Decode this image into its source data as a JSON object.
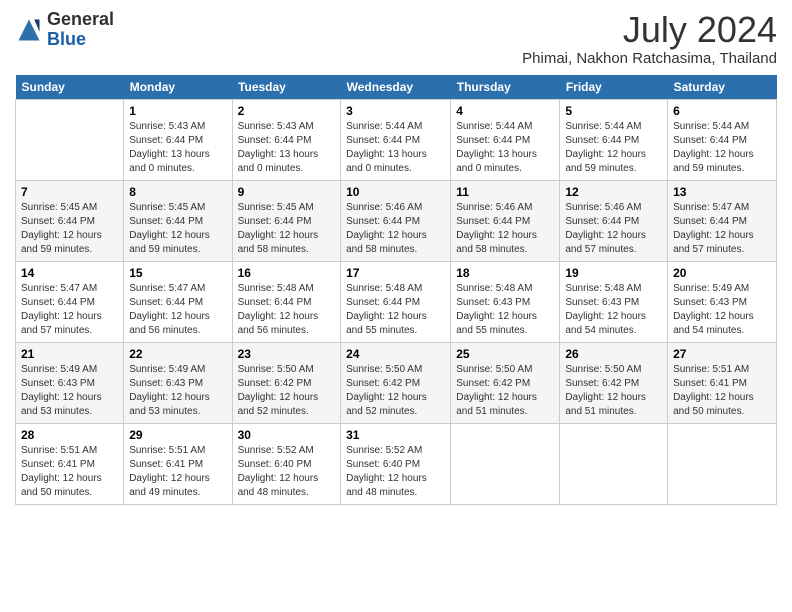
{
  "header": {
    "logo_general": "General",
    "logo_blue": "Blue",
    "month_year": "July 2024",
    "location": "Phimai, Nakhon Ratchasima, Thailand"
  },
  "weekdays": [
    "Sunday",
    "Monday",
    "Tuesday",
    "Wednesday",
    "Thursday",
    "Friday",
    "Saturday"
  ],
  "weeks": [
    [
      {
        "day": "",
        "sunrise": "",
        "sunset": "",
        "daylight": ""
      },
      {
        "day": "1",
        "sunrise": "Sunrise: 5:43 AM",
        "sunset": "Sunset: 6:44 PM",
        "daylight": "Daylight: 13 hours and 0 minutes."
      },
      {
        "day": "2",
        "sunrise": "Sunrise: 5:43 AM",
        "sunset": "Sunset: 6:44 PM",
        "daylight": "Daylight: 13 hours and 0 minutes."
      },
      {
        "day": "3",
        "sunrise": "Sunrise: 5:44 AM",
        "sunset": "Sunset: 6:44 PM",
        "daylight": "Daylight: 13 hours and 0 minutes."
      },
      {
        "day": "4",
        "sunrise": "Sunrise: 5:44 AM",
        "sunset": "Sunset: 6:44 PM",
        "daylight": "Daylight: 13 hours and 0 minutes."
      },
      {
        "day": "5",
        "sunrise": "Sunrise: 5:44 AM",
        "sunset": "Sunset: 6:44 PM",
        "daylight": "Daylight: 12 hours and 59 minutes."
      },
      {
        "day": "6",
        "sunrise": "Sunrise: 5:44 AM",
        "sunset": "Sunset: 6:44 PM",
        "daylight": "Daylight: 12 hours and 59 minutes."
      }
    ],
    [
      {
        "day": "7",
        "sunrise": "Sunrise: 5:45 AM",
        "sunset": "Sunset: 6:44 PM",
        "daylight": "Daylight: 12 hours and 59 minutes."
      },
      {
        "day": "8",
        "sunrise": "Sunrise: 5:45 AM",
        "sunset": "Sunset: 6:44 PM",
        "daylight": "Daylight: 12 hours and 59 minutes."
      },
      {
        "day": "9",
        "sunrise": "Sunrise: 5:45 AM",
        "sunset": "Sunset: 6:44 PM",
        "daylight": "Daylight: 12 hours and 58 minutes."
      },
      {
        "day": "10",
        "sunrise": "Sunrise: 5:46 AM",
        "sunset": "Sunset: 6:44 PM",
        "daylight": "Daylight: 12 hours and 58 minutes."
      },
      {
        "day": "11",
        "sunrise": "Sunrise: 5:46 AM",
        "sunset": "Sunset: 6:44 PM",
        "daylight": "Daylight: 12 hours and 58 minutes."
      },
      {
        "day": "12",
        "sunrise": "Sunrise: 5:46 AM",
        "sunset": "Sunset: 6:44 PM",
        "daylight": "Daylight: 12 hours and 57 minutes."
      },
      {
        "day": "13",
        "sunrise": "Sunrise: 5:47 AM",
        "sunset": "Sunset: 6:44 PM",
        "daylight": "Daylight: 12 hours and 57 minutes."
      }
    ],
    [
      {
        "day": "14",
        "sunrise": "Sunrise: 5:47 AM",
        "sunset": "Sunset: 6:44 PM",
        "daylight": "Daylight: 12 hours and 57 minutes."
      },
      {
        "day": "15",
        "sunrise": "Sunrise: 5:47 AM",
        "sunset": "Sunset: 6:44 PM",
        "daylight": "Daylight: 12 hours and 56 minutes."
      },
      {
        "day": "16",
        "sunrise": "Sunrise: 5:48 AM",
        "sunset": "Sunset: 6:44 PM",
        "daylight": "Daylight: 12 hours and 56 minutes."
      },
      {
        "day": "17",
        "sunrise": "Sunrise: 5:48 AM",
        "sunset": "Sunset: 6:44 PM",
        "daylight": "Daylight: 12 hours and 55 minutes."
      },
      {
        "day": "18",
        "sunrise": "Sunrise: 5:48 AM",
        "sunset": "Sunset: 6:43 PM",
        "daylight": "Daylight: 12 hours and 55 minutes."
      },
      {
        "day": "19",
        "sunrise": "Sunrise: 5:48 AM",
        "sunset": "Sunset: 6:43 PM",
        "daylight": "Daylight: 12 hours and 54 minutes."
      },
      {
        "day": "20",
        "sunrise": "Sunrise: 5:49 AM",
        "sunset": "Sunset: 6:43 PM",
        "daylight": "Daylight: 12 hours and 54 minutes."
      }
    ],
    [
      {
        "day": "21",
        "sunrise": "Sunrise: 5:49 AM",
        "sunset": "Sunset: 6:43 PM",
        "daylight": "Daylight: 12 hours and 53 minutes."
      },
      {
        "day": "22",
        "sunrise": "Sunrise: 5:49 AM",
        "sunset": "Sunset: 6:43 PM",
        "daylight": "Daylight: 12 hours and 53 minutes."
      },
      {
        "day": "23",
        "sunrise": "Sunrise: 5:50 AM",
        "sunset": "Sunset: 6:42 PM",
        "daylight": "Daylight: 12 hours and 52 minutes."
      },
      {
        "day": "24",
        "sunrise": "Sunrise: 5:50 AM",
        "sunset": "Sunset: 6:42 PM",
        "daylight": "Daylight: 12 hours and 52 minutes."
      },
      {
        "day": "25",
        "sunrise": "Sunrise: 5:50 AM",
        "sunset": "Sunset: 6:42 PM",
        "daylight": "Daylight: 12 hours and 51 minutes."
      },
      {
        "day": "26",
        "sunrise": "Sunrise: 5:50 AM",
        "sunset": "Sunset: 6:42 PM",
        "daylight": "Daylight: 12 hours and 51 minutes."
      },
      {
        "day": "27",
        "sunrise": "Sunrise: 5:51 AM",
        "sunset": "Sunset: 6:41 PM",
        "daylight": "Daylight: 12 hours and 50 minutes."
      }
    ],
    [
      {
        "day": "28",
        "sunrise": "Sunrise: 5:51 AM",
        "sunset": "Sunset: 6:41 PM",
        "daylight": "Daylight: 12 hours and 50 minutes."
      },
      {
        "day": "29",
        "sunrise": "Sunrise: 5:51 AM",
        "sunset": "Sunset: 6:41 PM",
        "daylight": "Daylight: 12 hours and 49 minutes."
      },
      {
        "day": "30",
        "sunrise": "Sunrise: 5:52 AM",
        "sunset": "Sunset: 6:40 PM",
        "daylight": "Daylight: 12 hours and 48 minutes."
      },
      {
        "day": "31",
        "sunrise": "Sunrise: 5:52 AM",
        "sunset": "Sunset: 6:40 PM",
        "daylight": "Daylight: 12 hours and 48 minutes."
      },
      {
        "day": "",
        "sunrise": "",
        "sunset": "",
        "daylight": ""
      },
      {
        "day": "",
        "sunrise": "",
        "sunset": "",
        "daylight": ""
      },
      {
        "day": "",
        "sunrise": "",
        "sunset": "",
        "daylight": ""
      }
    ]
  ]
}
